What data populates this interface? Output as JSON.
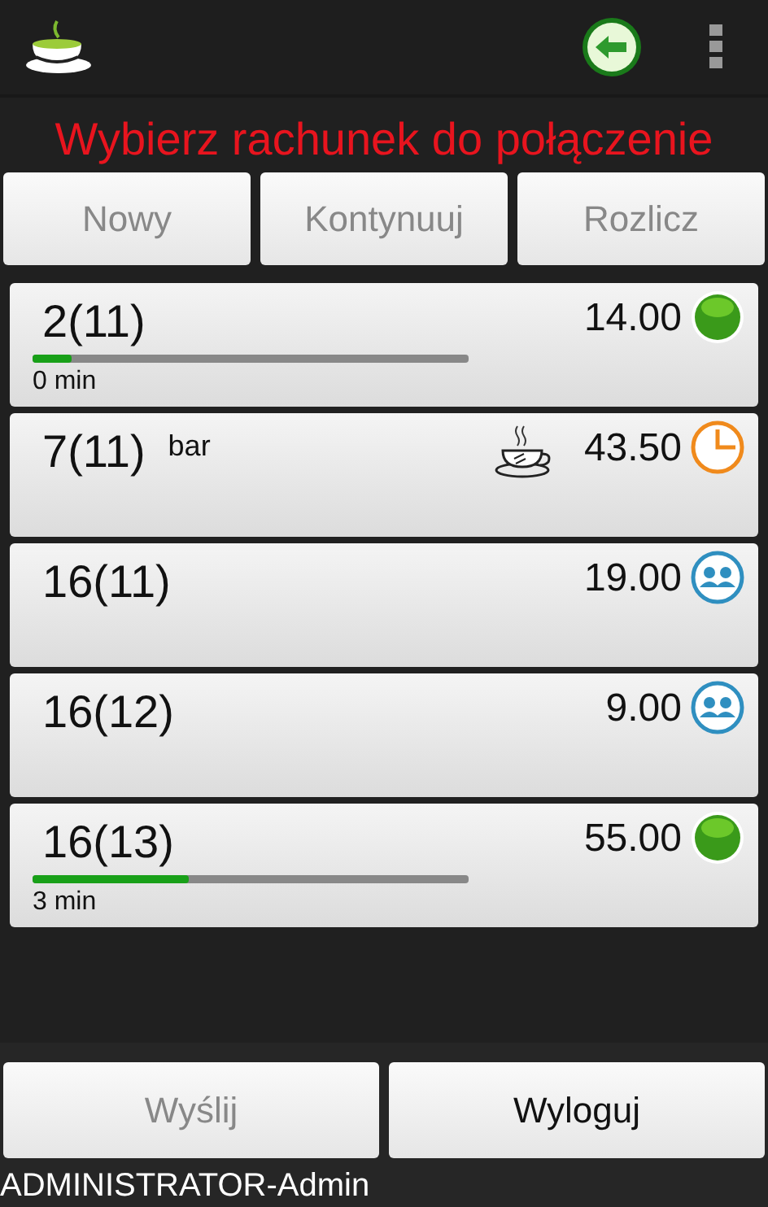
{
  "header_title": "Wybierz rachunek do połączenie",
  "actions": [
    {
      "label": "Nowy",
      "disabled": true
    },
    {
      "label": "Kontynuuj",
      "disabled": true
    },
    {
      "label": "Rozlicz",
      "disabled": true
    }
  ],
  "bills": [
    {
      "name": "2(11)",
      "amount": "14.00",
      "kind": "active",
      "level": 0.09,
      "time": "0 min"
    },
    {
      "name": "7(11)",
      "note": "bar",
      "cup": true,
      "amount": "43.50",
      "kind": "waiting"
    },
    {
      "name": "16(11)",
      "amount": "19.00",
      "kind": "guests"
    },
    {
      "name": "16(12)",
      "amount": "9.00",
      "kind": "guests"
    },
    {
      "name": "16(13)",
      "amount": "55.00",
      "kind": "active",
      "level": 0.36,
      "time": "3 min"
    }
  ],
  "footer_buttons": [
    {
      "label": "Wyślij",
      "disabled": true
    },
    {
      "label": "Wyloguj",
      "disabled": false
    }
  ],
  "user": "ADMINISTRATOR-Admin"
}
